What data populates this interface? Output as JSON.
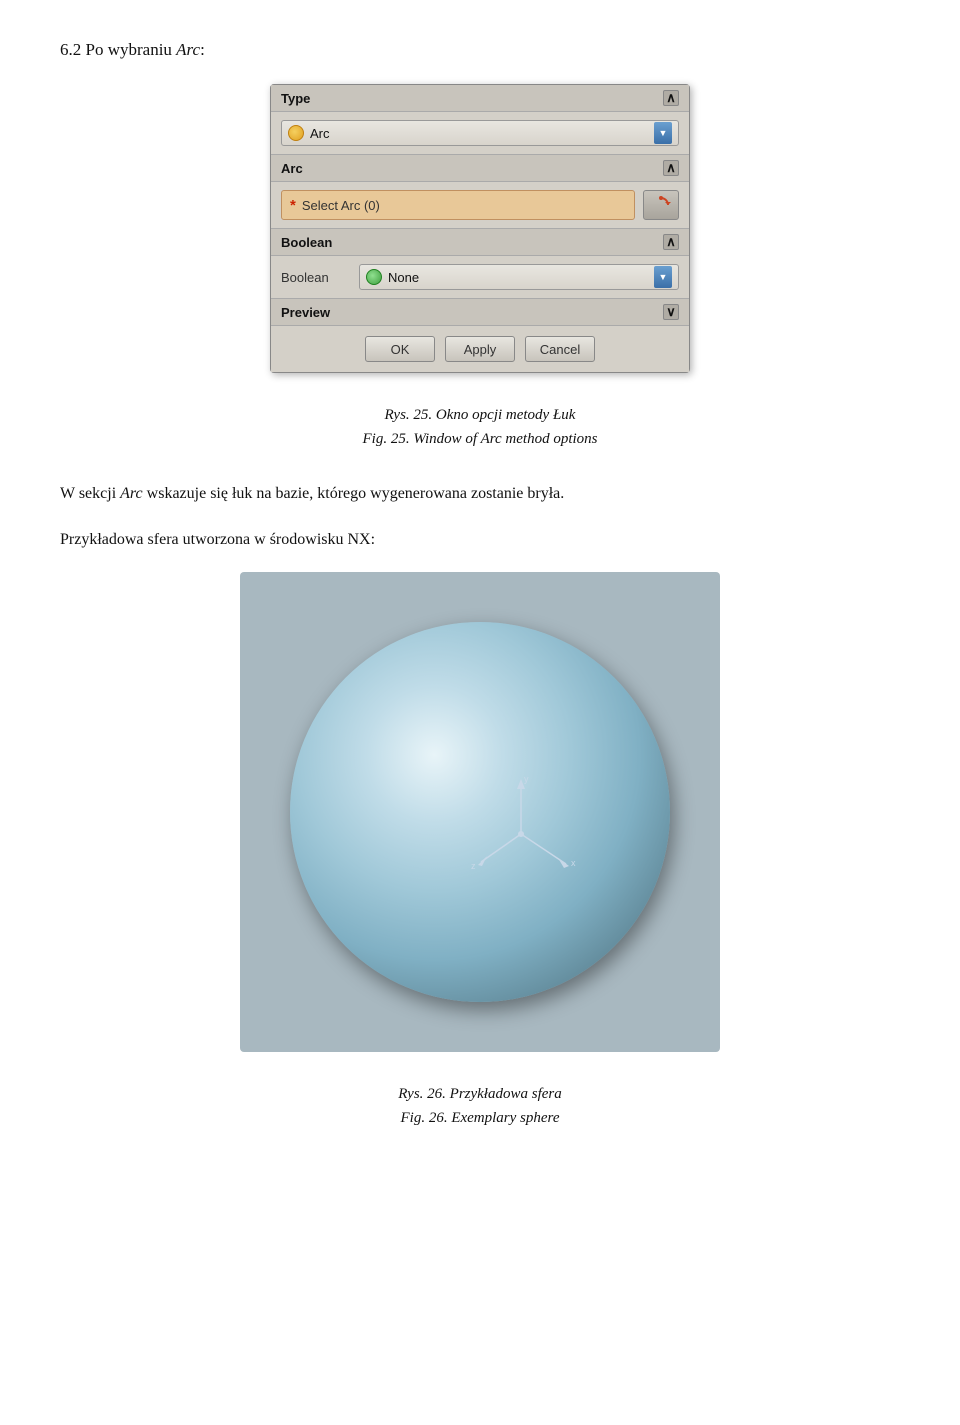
{
  "heading": {
    "number": "6.2",
    "text": " Po wybraniu ",
    "arc_italic": "Arc",
    "colon": ":"
  },
  "dialog": {
    "sections": {
      "type": {
        "label": "Type",
        "collapse_symbol": "∧",
        "dropdown": {
          "icon": "arc-icon",
          "value": "Arc",
          "arrow": "▼"
        }
      },
      "arc": {
        "label": "Arc",
        "collapse_symbol": "∧",
        "select_field": {
          "asterisk": "*",
          "label": "Select Arc (0)"
        },
        "button_icon": "↺"
      },
      "boolean": {
        "label": "Boolean",
        "collapse_symbol": "∧",
        "field_label": "Boolean",
        "dropdown": {
          "icon": "none-icon",
          "value": "None",
          "arrow": "▼"
        }
      },
      "preview": {
        "label": "Preview",
        "expand_symbol": "∨"
      }
    },
    "footer": {
      "ok_label": "OK",
      "apply_label": "Apply",
      "cancel_label": "Cancel"
    }
  },
  "caption1": {
    "line1": "Rys. 25. Okno opcji metody Łuk",
    "line2": "Fig. 25. Window of Arc method options"
  },
  "body_text1": "W sekcji Arc wskazuje się łuk na bazie, którego wygenerowana zostanie bryła.",
  "body_text2": "Przykładowa sfera utworzona w środowisku NX:",
  "caption2": {
    "line1": "Rys. 26. Przykładowa sfera",
    "line2": "Fig. 26. Exemplary sphere"
  }
}
